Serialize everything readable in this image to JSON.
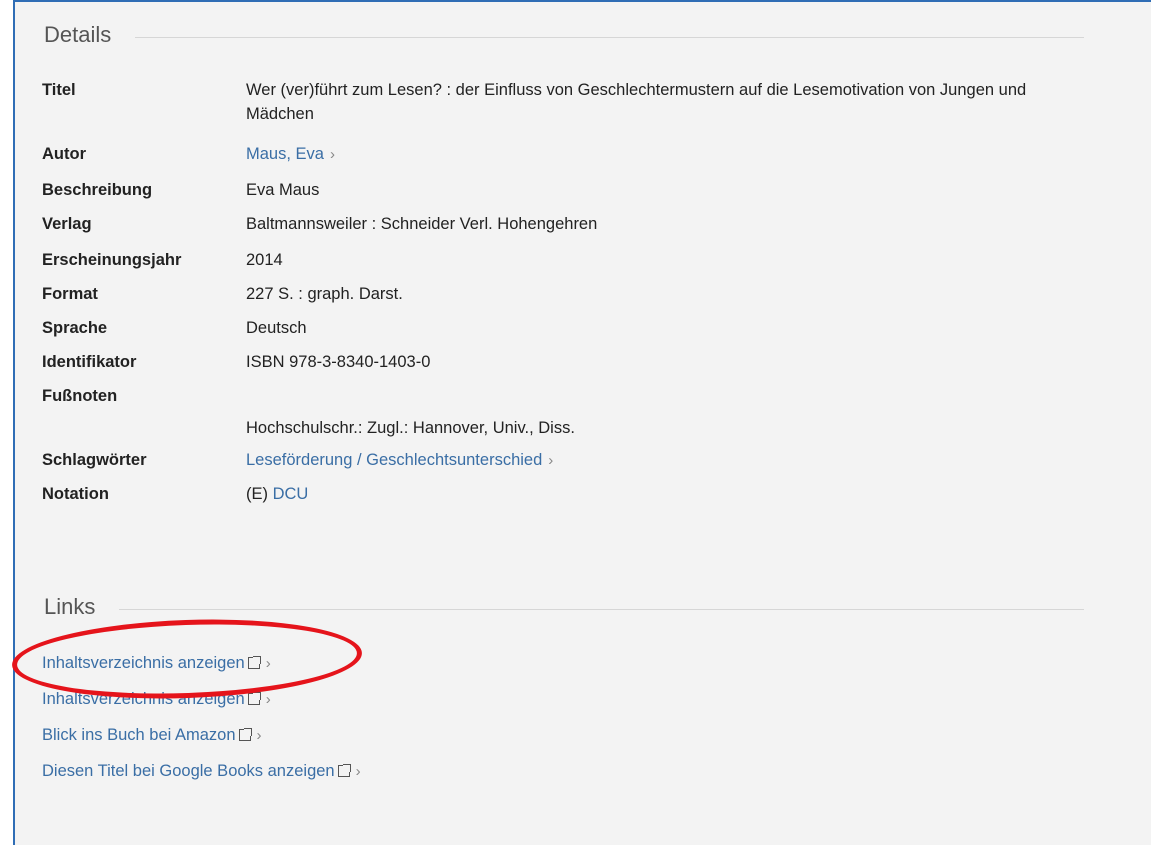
{
  "details": {
    "heading": "Details",
    "rows": [
      {
        "label": "Titel",
        "value": "Wer (ver)führt zum Lesen? : der Einfluss von Geschlechtermustern auf die Lesemotivation von Jungen und Mädchen"
      },
      {
        "label": "Autor",
        "value": "Maus, Eva"
      },
      {
        "label": "Beschreibung",
        "value": "Eva Maus"
      },
      {
        "label": "Verlag",
        "value": "Baltmannsweiler : Schneider Verl. Hohengehren"
      },
      {
        "label": "Erscheinungsjahr",
        "value": "2014"
      },
      {
        "label": "Format",
        "value": "227 S. : graph. Darst."
      },
      {
        "label": "Sprache",
        "value": "Deutsch"
      },
      {
        "label": "Identifikator",
        "value": "ISBN 978-3-8340-1403-0"
      },
      {
        "label": "Fußnoten",
        "value": "Hochschulschr.: Zugl.: Hannover, Univ., Diss."
      },
      {
        "label": "Schlagwörter",
        "value": "Leseförderung / Geschlechtsunterschied"
      },
      {
        "label": "Notation",
        "prefix": "(E)",
        "value": "DCU"
      }
    ]
  },
  "links": {
    "heading": "Links",
    "items": [
      {
        "label": "Inhaltsverzeichnis anzeigen"
      },
      {
        "label": "Inhaltsverzeichnis anzeigen"
      },
      {
        "label": "Blick ins Buch bei Amazon"
      },
      {
        "label": "Diesen Titel bei Google Books anzeigen"
      }
    ]
  },
  "icons": {
    "external": "external-link-icon",
    "chevron": "chevron-right-icon"
  },
  "colors": {
    "link": "#3a6ea5",
    "highlight_circle": "#e5141b",
    "frame_border": "#2f6db5"
  }
}
